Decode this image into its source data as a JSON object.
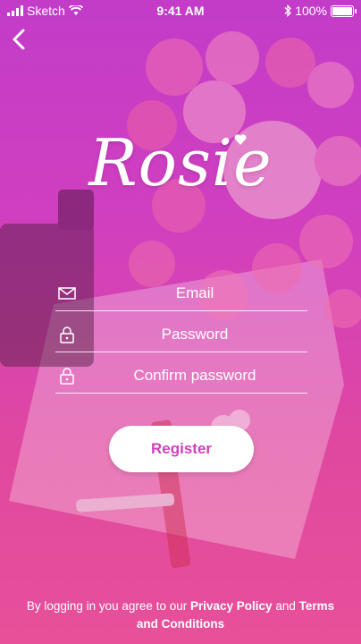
{
  "status_bar": {
    "carrier": "Sketch",
    "time": "9:41 AM",
    "battery": "100%"
  },
  "brand": {
    "name": "Rosie"
  },
  "form": {
    "email_placeholder": "Email",
    "password_placeholder": "Password",
    "confirm_placeholder": "Confirm password",
    "register_label": "Register"
  },
  "legal": {
    "prefix": "By logging in you agree to our",
    "privacy": "Privacy Policy",
    "and": "and",
    "terms": "Terms and Conditions"
  },
  "colors": {
    "gradient_top": "#c23cc8",
    "gradient_bottom": "#e8509a",
    "accent": "#d13fbf",
    "text": "#ffffff"
  },
  "icons": [
    "signal-icon",
    "wifi-icon",
    "bluetooth-icon",
    "battery-icon",
    "back-chevron-icon",
    "mail-icon",
    "lock-icon"
  ]
}
